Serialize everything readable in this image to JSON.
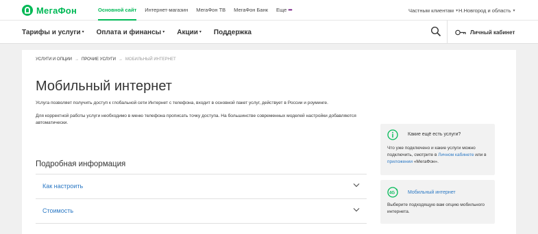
{
  "topbar": {
    "logo_text": "МегаФон",
    "nav": [
      {
        "label": "Основной сайт",
        "active": true
      },
      {
        "label": "Интернет-магазин",
        "active": false
      },
      {
        "label": "МегаФон ТВ",
        "active": false
      },
      {
        "label": "МегаФон Банк",
        "active": false
      },
      {
        "label": "Еще",
        "active": false
      }
    ],
    "client_type": "Частным клиентам",
    "region": "Н.Новгород и область"
  },
  "mainnav": {
    "items": [
      "Тарифы и услуги",
      "Оплата и финансы",
      "Акции",
      "Поддержка"
    ],
    "cabinet_label": "Личный кабинет"
  },
  "breadcrumbs": [
    "Услуги и опции",
    "Прочие услуги",
    "Мобильный интернет"
  ],
  "page": {
    "title": "Мобильный интернет",
    "desc1": "Услуга позволяет получить доступ к глобальной сети Интернет с телефона, входит в основной пакет услуг, действует в России и роуминге.",
    "desc2": "Для корректной работы услуги необходимо в меню телефона прописать точку доступа. На большинстве современных моделей настройки добавляются автоматически.",
    "section_title": "Подробная информация",
    "accordion": [
      "Как настроить",
      "Стоимость"
    ]
  },
  "side": {
    "box1": {
      "title": "Какие ещё есть услуги?",
      "text_a": "Что уже подключено и какие услуги можно подключить, смотрите в",
      "link_a": "Личном кабинете",
      "text_b": "или в",
      "link_b": "приложении",
      "text_c": "«МегаФон»."
    },
    "box2": {
      "title": "Мобильный интернет",
      "text": "Выберите подходящую вам опцию мобильного интернета."
    }
  },
  "colors": {
    "brand_green": "#00b956",
    "link_blue": "#2b78c4",
    "brand_purple": "#731982"
  },
  "icons": [
    "megafon-logo-icon",
    "more-dots-icon",
    "chevron-down-icon",
    "search-icon",
    "key-icon",
    "info-icon",
    "lte-icon"
  ]
}
